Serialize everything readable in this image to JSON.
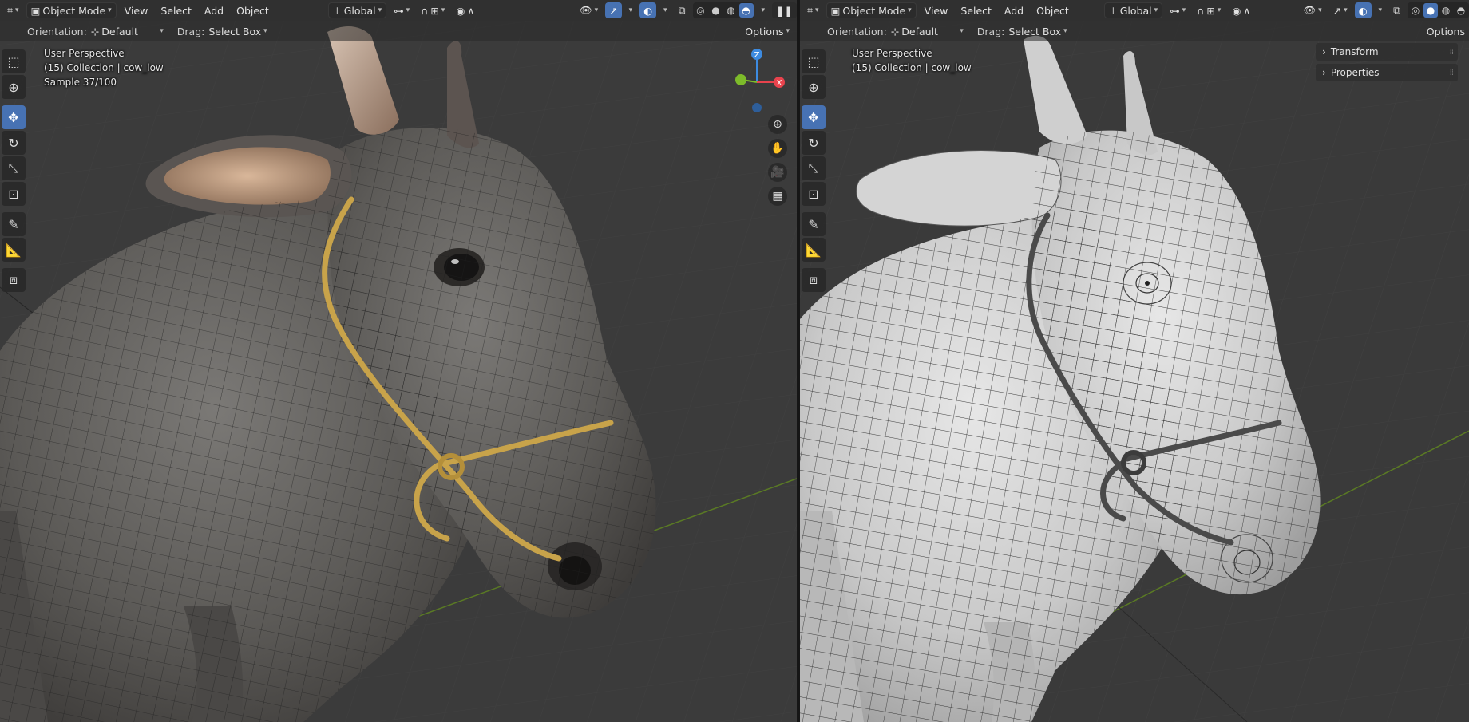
{
  "left": {
    "header": {
      "mode": "Object Mode",
      "menus": [
        "View",
        "Select",
        "Add",
        "Object"
      ],
      "transform_space": "Global"
    },
    "toolrow": {
      "orientation_label": "Orientation:",
      "orientation_value": "Default",
      "drag_label": "Drag:",
      "drag_value": "Select Box",
      "options": "Options"
    },
    "overlay": {
      "perspective": "User Perspective",
      "collection": "(15) Collection | cow_low",
      "sample": "Sample 37/100"
    },
    "shading": "rendered"
  },
  "right": {
    "header": {
      "mode": "Object Mode",
      "menus": [
        "View",
        "Select",
        "Add",
        "Object"
      ],
      "transform_space": "Global"
    },
    "toolrow": {
      "orientation_label": "Orientation:",
      "orientation_value": "Default",
      "drag_label": "Drag:",
      "drag_value": "Select Box",
      "options": "Options"
    },
    "overlay": {
      "perspective": "User Perspective",
      "collection": "(15) Collection | cow_low"
    },
    "sidebar": {
      "panels": [
        "Transform",
        "Properties"
      ]
    },
    "shading": "solid"
  },
  "gizmo": {
    "x": "X",
    "y": "Y",
    "z": "Z"
  },
  "colors": {
    "accent": "#4772b3",
    "header_bg": "#303030",
    "viewport_bg": "#3a3a3a",
    "axis_x": "#e8434d",
    "axis_y": "#7dbb2a",
    "axis_z": "#3d8be0",
    "rope": "#c8a34a"
  },
  "icons": {
    "editor_type": "view3d-icon",
    "tools": [
      "select-box-icon",
      "cursor-icon",
      "move-icon",
      "rotate-icon",
      "scale-icon",
      "transform-icon",
      "annotate-icon",
      "measure-icon",
      "add-cube-icon"
    ],
    "nav": [
      "zoom-icon",
      "pan-hand-icon",
      "camera-icon",
      "grid-perspective-icon"
    ]
  }
}
